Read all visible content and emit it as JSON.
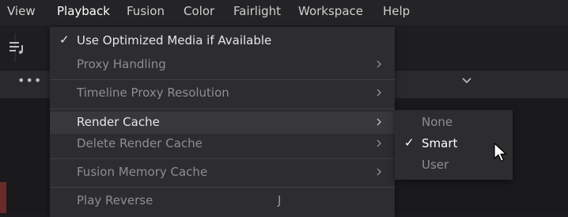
{
  "menubar": {
    "items": [
      {
        "label": "View"
      },
      {
        "label": "Playback",
        "active": true
      },
      {
        "label": "Fusion"
      },
      {
        "label": "Color"
      },
      {
        "label": "Fairlight"
      },
      {
        "label": "Workspace"
      },
      {
        "label": "Help"
      }
    ]
  },
  "background": {
    "toolbar_icon": "list-music-icon",
    "more_label": "•••",
    "dropdown_icon": "chevron-down-icon"
  },
  "playback_menu": {
    "items": [
      {
        "label": "Use Optimized Media if Available",
        "checked": true,
        "enabled": true,
        "submenu": false
      },
      {
        "label": "Proxy Handling",
        "checked": false,
        "enabled": false,
        "submenu": true
      },
      {
        "label": "Timeline Proxy Resolution",
        "checked": false,
        "enabled": false,
        "submenu": true
      },
      {
        "label": "Render Cache",
        "checked": false,
        "enabled": true,
        "submenu": true,
        "highlighted": true
      },
      {
        "label": "Delete Render Cache",
        "checked": false,
        "enabled": false,
        "submenu": true
      },
      {
        "label": "Fusion Memory Cache",
        "checked": false,
        "enabled": false,
        "submenu": true
      },
      {
        "label": "Play Reverse",
        "checked": false,
        "enabled": false,
        "submenu": false,
        "shortcut": "J"
      }
    ]
  },
  "render_cache_submenu": {
    "items": [
      {
        "label": "None",
        "checked": false,
        "enabled": false
      },
      {
        "label": "Smart",
        "checked": true,
        "enabled": true
      },
      {
        "label": "User",
        "checked": false,
        "enabled": false
      }
    ]
  },
  "glyphs": {
    "check": "✓"
  },
  "colors": {
    "menu_bg": "#2d2d30",
    "highlight_bg": "#38383c",
    "text_enabled": "#e6e6e6",
    "text_disabled": "#8e8e90"
  }
}
